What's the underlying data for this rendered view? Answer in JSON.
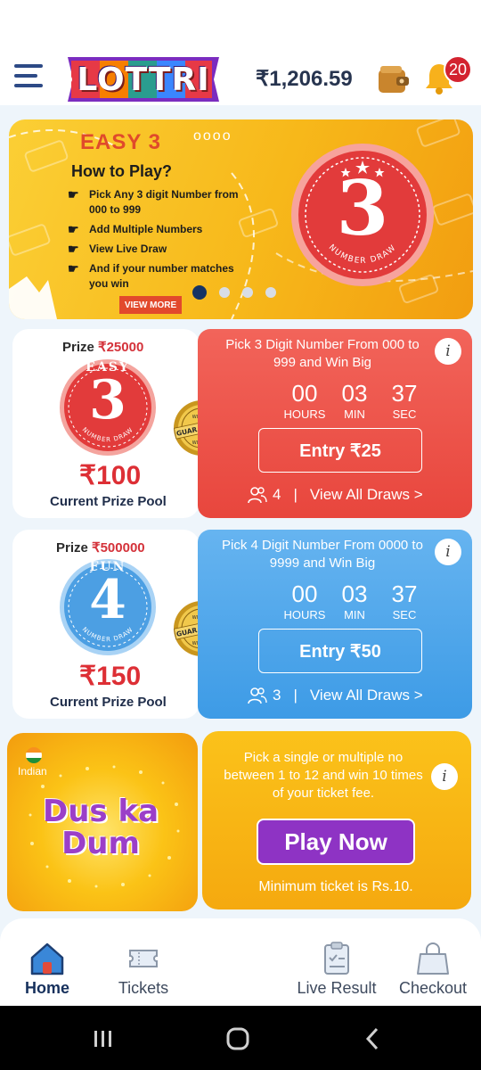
{
  "header": {
    "logo_text": "LOTTRI",
    "balance": "₹1,206.59",
    "notification_count": "20"
  },
  "banner": {
    "title": "EASY 3",
    "dots": "oooo",
    "subtitle": "How to Play?",
    "steps": [
      "Pick Any 3 digit Number from 000 to 999",
      "Add Multiple Numbers",
      "View Live Draw",
      "And if your number matches you win"
    ],
    "view_more": "VIEW MORE",
    "badge_digit": "3",
    "badge_caption": "NUMBER DRAW",
    "active_slide": 1,
    "slide_count": 4
  },
  "games": [
    {
      "prize_label": "Prize",
      "prize_amount": "₹25000",
      "badge_word": "EASY",
      "badge_digit": "3",
      "badge_caption": "NUMBER DRAW",
      "pool_amount": "₹100",
      "pool_label": "Current Prize Pool",
      "seal_text": "GUARANTEED",
      "seal_sub": "WINNER",
      "description": "Pick 3 Digit Number From 000 to 999 and Win Big",
      "timer": {
        "hours": "00",
        "min": "03",
        "sec": "37",
        "hours_label": "HOURS",
        "min_label": "MIN",
        "sec_label": "SEC"
      },
      "entry_label": "Entry ₹25",
      "players": "4",
      "separator": "|",
      "view_all": "View All Draws >",
      "info": "i",
      "color": "#ee5548"
    },
    {
      "prize_label": "Prize",
      "prize_amount": "₹500000",
      "badge_word": "FUN",
      "badge_digit": "4",
      "badge_caption": "NUMBER DRAW",
      "pool_amount": "₹150",
      "pool_label": "Current Prize Pool",
      "seal_text": "GUARANTEED",
      "seal_sub": "WINNER",
      "description": "Pick 4 Digit Number From 0000 to 9999 and Win Big",
      "timer": {
        "hours": "00",
        "min": "03",
        "sec": "37",
        "hours_label": "HOURS",
        "min_label": "MIN",
        "sec_label": "SEC"
      },
      "entry_label": "Entry ₹50",
      "players": "3",
      "separator": "|",
      "view_all": "View All Draws >",
      "info": "i",
      "color": "#4aa6ec"
    }
  ],
  "dus_ka_dum": {
    "flag_label": "Indian",
    "title_line1": "Dus ka",
    "title_line2": "Dum",
    "description": "Pick a single or multiple no between 1 to 12 and win 10 times of your ticket fee.",
    "play_label": "Play Now",
    "minimum": "Minimum ticket is Rs.10.",
    "info": "i"
  },
  "bottom_nav": [
    {
      "label": "Home",
      "icon": "home-icon",
      "active": true
    },
    {
      "label": "Tickets",
      "icon": "ticket-icon",
      "active": false
    },
    {
      "label": "Live Result",
      "icon": "clipboard-icon",
      "active": false
    },
    {
      "label": "Checkout",
      "icon": "bag-icon",
      "active": false
    }
  ],
  "colors": {
    "brand_red": "#dd2f35",
    "easy3_card": "#ee5548",
    "fun4_card": "#4aa6ec",
    "banner_yellow": "#fbcf35",
    "play_purple": "#8e33c4",
    "navy": "#16305c"
  }
}
